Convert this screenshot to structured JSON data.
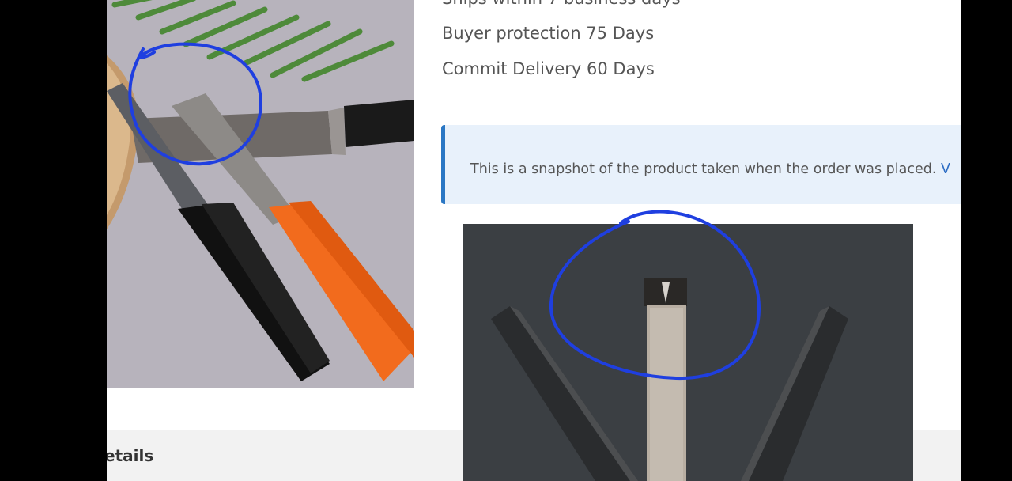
{
  "shipping": {
    "ships_within": "Ships within 7 business days",
    "buyer_protection": "Buyer protection 75 Days",
    "commit_delivery": "Commit Delivery 60 Days"
  },
  "notice": {
    "text": "This is a snapshot of the product taken when the order was placed. ",
    "link": "V"
  },
  "section": {
    "details_label": "etails"
  },
  "colors": {
    "annotation": "#1f3fe0",
    "notice_border": "#2b77c4",
    "notice_bg": "#e8f1fb"
  }
}
